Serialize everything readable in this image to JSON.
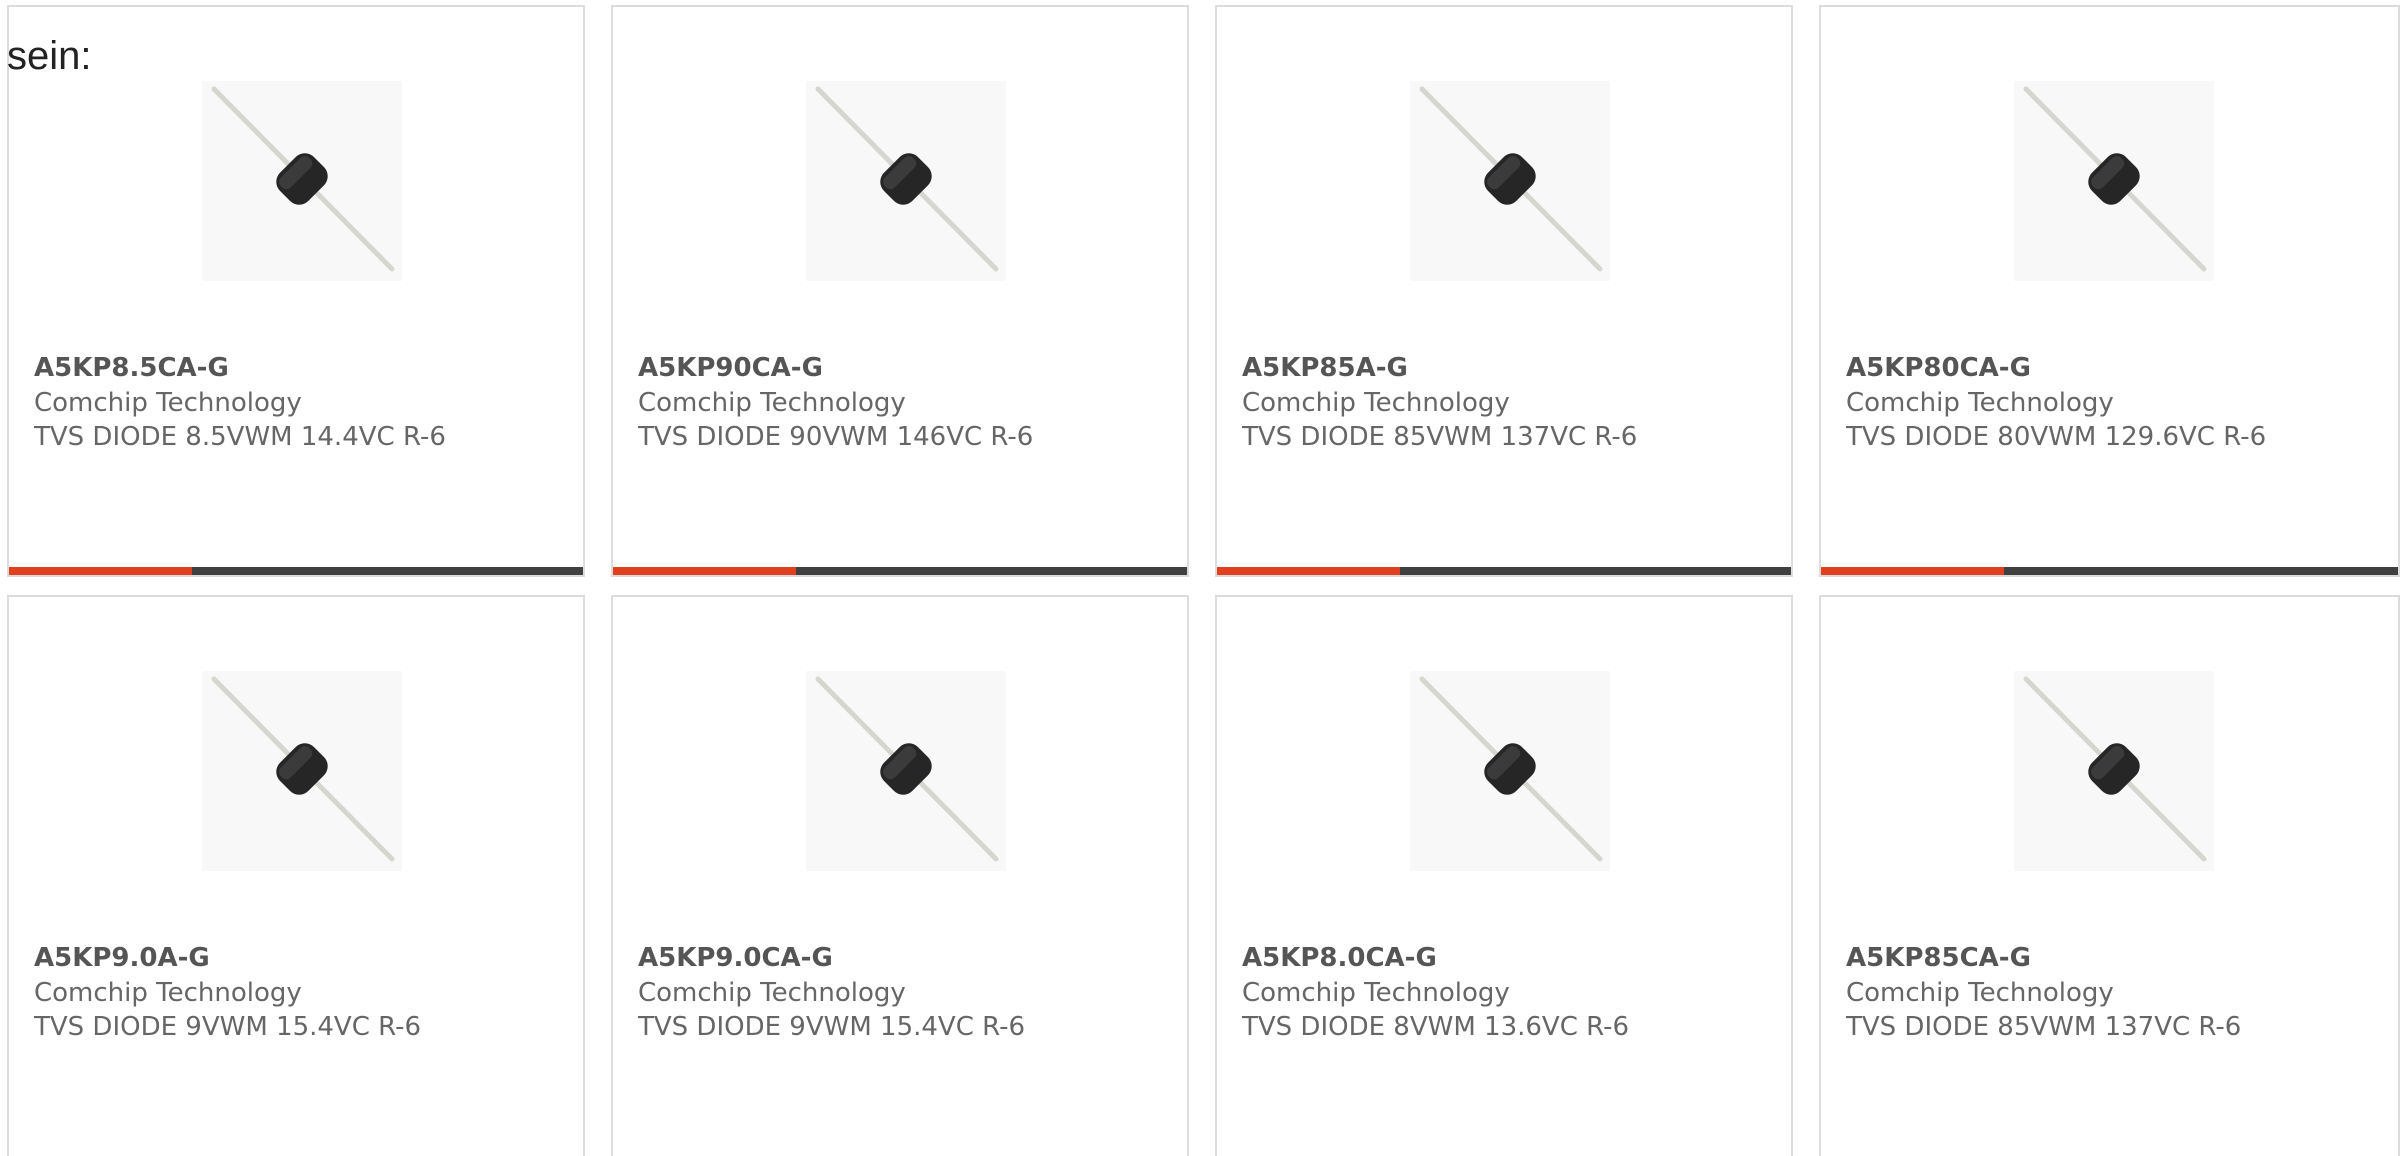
{
  "intro_text": "sein:",
  "colors": {
    "accent": "#e0401e",
    "bar_track": "#404040",
    "card_border": "#dcdcdc",
    "text": "#666666"
  },
  "cards": [
    {
      "part": "A5KP8.5CA-G",
      "manufacturer": "Comchip Technology",
      "description": "TVS DIODE 8.5VWM 14.4VC R-6",
      "image_icon": "axial-diode-image"
    },
    {
      "part": "A5KP90CA-G",
      "manufacturer": "Comchip Technology",
      "description": "TVS DIODE 90VWM 146VC R-6",
      "image_icon": "axial-diode-image"
    },
    {
      "part": "A5KP85A-G",
      "manufacturer": "Comchip Technology",
      "description": "TVS DIODE 85VWM 137VC R-6",
      "image_icon": "axial-diode-image"
    },
    {
      "part": "A5KP80CA-G",
      "manufacturer": "Comchip Technology",
      "description": "TVS DIODE 80VWM 129.6VC R-6",
      "image_icon": "axial-diode-image"
    },
    {
      "part": "A5KP9.0A-G",
      "manufacturer": "Comchip Technology",
      "description": "TVS DIODE 9VWM 15.4VC R-6",
      "image_icon": "axial-diode-image"
    },
    {
      "part": "A5KP9.0CA-G",
      "manufacturer": "Comchip Technology",
      "description": "TVS DIODE 9VWM 15.4VC R-6",
      "image_icon": "axial-diode-image"
    },
    {
      "part": "A5KP8.0CA-G",
      "manufacturer": "Comchip Technology",
      "description": "TVS DIODE 8VWM 13.6VC R-6",
      "image_icon": "axial-diode-image"
    },
    {
      "part": "A5KP85CA-G",
      "manufacturer": "Comchip Technology",
      "description": "TVS DIODE 85VWM 137VC R-6",
      "image_icon": "axial-diode-image"
    }
  ]
}
